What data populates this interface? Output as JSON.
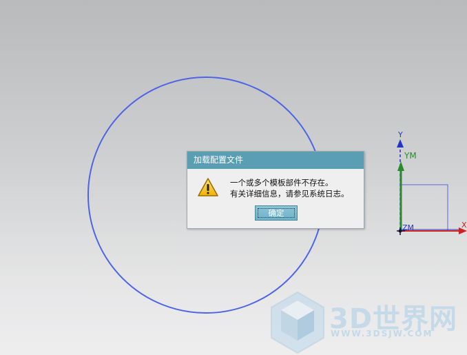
{
  "dialog": {
    "title": "加载配置文件",
    "message_line1": "一个或多个模板部件不存在。",
    "message_line2": "有关详细信息，请参见系统日志。",
    "ok_label": "确定",
    "title_color": "#5a9eb4"
  },
  "axes": {
    "y_label": "Y",
    "ym_label": "YM",
    "zm_label": "ZM",
    "x_label": "X"
  },
  "colors": {
    "circle": "#4a63e8",
    "y_axis": "#2233cc",
    "ym_axis": "#2b8a2b",
    "x_axis": "#cc2222"
  },
  "watermark": {
    "brand": "3D世界网",
    "url": "WWW.3DSJW.COM"
  }
}
